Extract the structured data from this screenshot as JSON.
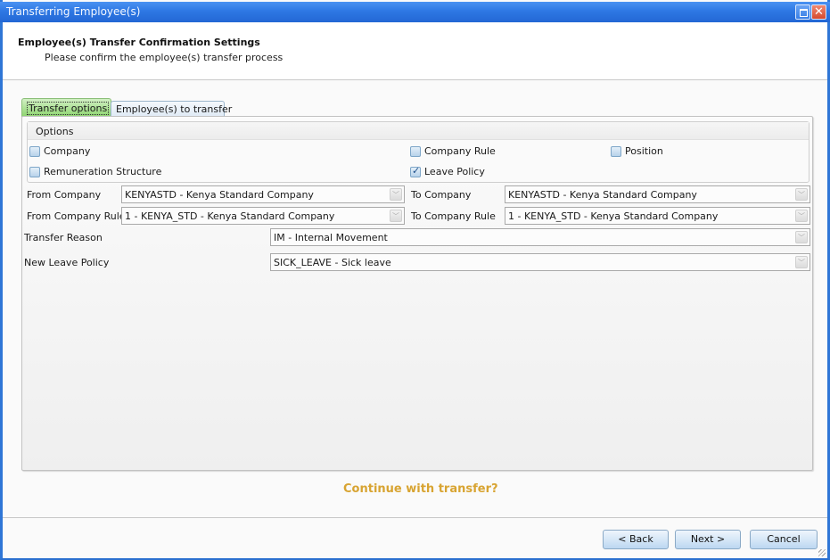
{
  "window": {
    "title": "Transferring Employee(s)",
    "maximize_icon": "maximize-icon",
    "close_icon": "close-icon"
  },
  "header": {
    "title": "Employee(s) Transfer Confirmation Settings",
    "subtitle": "Please confirm the employee(s) transfer process"
  },
  "tabs": [
    {
      "label": "Transfer options",
      "active": true
    },
    {
      "label": "Employee(s) to transfer",
      "active": false
    }
  ],
  "options": {
    "heading": "Options",
    "items": [
      {
        "label": "Company",
        "checked": false
      },
      {
        "label": "Company Rule",
        "checked": false
      },
      {
        "label": "Position",
        "checked": false
      },
      {
        "label": "Remuneration Structure",
        "checked": false
      },
      {
        "label": "Leave Policy",
        "checked": true
      }
    ]
  },
  "fields": {
    "from_company": {
      "label": "From Company",
      "value": "KENYASTD - Kenya Standard Company"
    },
    "to_company": {
      "label": "To Company",
      "value": "KENYASTD - Kenya Standard Company"
    },
    "from_company_rule": {
      "label": "From Company Rule",
      "value": "1 - KENYA_STD - Kenya Standard Company"
    },
    "to_company_rule": {
      "label": "To Company Rule",
      "value": "1 - KENYA_STD - Kenya Standard Company"
    },
    "transfer_reason": {
      "label": "Transfer Reason",
      "value": "IM - Internal Movement"
    },
    "new_leave_policy": {
      "label": "New Leave Policy",
      "value": "SICK_LEAVE - Sick leave"
    },
    "dropdown_glyph": "﹀"
  },
  "confirm_question": "Continue with transfer?",
  "buttons": {
    "back": "< Back",
    "next": "Next >",
    "cancel": "Cancel"
  },
  "colors": {
    "titlebar": "#2e78e4",
    "active_tab": "#8cd46e",
    "question": "#d8a432"
  }
}
